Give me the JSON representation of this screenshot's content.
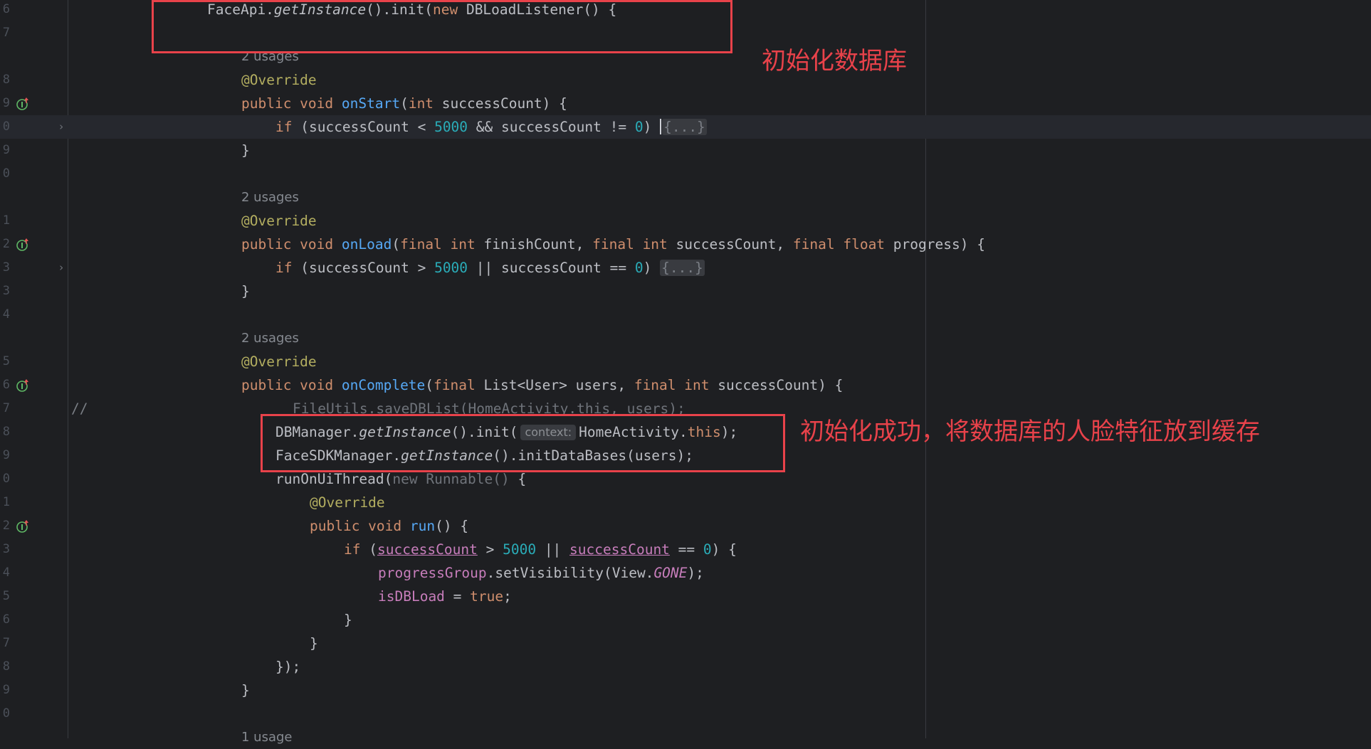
{
  "editor": {
    "lines": [
      {
        "n": "6",
        "hint": "",
        "code": [
          [
            "",
            "FaceApi."
          ],
          [
            "it",
            "getInstance"
          ],
          [
            "",
            "().init("
          ],
          [
            "kw",
            "new "
          ],
          [
            "",
            "DBLoadListener() {"
          ]
        ]
      },
      {
        "n": "7",
        "hint": "",
        "code": []
      },
      {
        "n": "",
        "hint": "2 usages",
        "code": []
      },
      {
        "n": "8",
        "hint": "",
        "code": [
          [
            "ann",
            "@Override"
          ]
        ]
      },
      {
        "n": "9",
        "hint": "",
        "icon": true,
        "code": [
          [
            "kw",
            "public void "
          ],
          [
            "fn",
            "onStart"
          ],
          [
            "",
            "("
          ],
          [
            "kw",
            "int "
          ],
          [
            "",
            "successCount) {"
          ]
        ]
      },
      {
        "n": "0",
        "hint": "",
        "current": true,
        "fold": true,
        "code": [
          [
            "kw",
            "if "
          ],
          [
            "",
            "(successCount < "
          ],
          [
            "num",
            "5000"
          ],
          [
            "",
            " && successCount != "
          ],
          [
            "num",
            "0"
          ],
          [
            "",
            ") "
          ],
          [
            "caret",
            ""
          ],
          [
            "foldph",
            "{...}"
          ]
        ]
      },
      {
        "n": "9",
        "hint": "",
        "code": [
          [
            "",
            "}"
          ]
        ]
      },
      {
        "n": "0",
        "hint": "",
        "code": []
      },
      {
        "n": "",
        "hint": "2 usages",
        "code": []
      },
      {
        "n": "1",
        "hint": "",
        "code": [
          [
            "ann",
            "@Override"
          ]
        ]
      },
      {
        "n": "2",
        "hint": "",
        "icon": true,
        "code": [
          [
            "kw",
            "public void "
          ],
          [
            "fn",
            "onLoad"
          ],
          [
            "",
            "("
          ],
          [
            "kw",
            "final int "
          ],
          [
            "",
            "finishCount, "
          ],
          [
            "kw",
            "final int "
          ],
          [
            "",
            "successCount, "
          ],
          [
            "kw",
            "final float "
          ],
          [
            "",
            "progress) {"
          ]
        ]
      },
      {
        "n": "3",
        "hint": "",
        "fold": true,
        "code": [
          [
            "kw",
            "if "
          ],
          [
            "",
            "(successCount > "
          ],
          [
            "num",
            "5000"
          ],
          [
            "",
            " || successCount == "
          ],
          [
            "num",
            "0"
          ],
          [
            "",
            ") "
          ],
          [
            "foldph",
            "{...}"
          ]
        ]
      },
      {
        "n": "3",
        "hint": "",
        "code": [
          [
            "",
            "}"
          ]
        ]
      },
      {
        "n": "4",
        "hint": "",
        "code": []
      },
      {
        "n": "",
        "hint": "2 usages",
        "code": []
      },
      {
        "n": "5",
        "hint": "",
        "code": [
          [
            "ann",
            "@Override"
          ]
        ]
      },
      {
        "n": "6",
        "hint": "",
        "icon": true,
        "code": [
          [
            "kw",
            "public void "
          ],
          [
            "fn",
            "onComplete"
          ],
          [
            "",
            "("
          ],
          [
            "kw",
            "final "
          ],
          [
            "",
            "List<User> users, "
          ],
          [
            "kw",
            "final int "
          ],
          [
            "",
            "successCount) {"
          ]
        ]
      },
      {
        "n": "7",
        "hint": "",
        "slash": "//",
        "code": [
          [
            "dim",
            "FileUtils.saveDBList(HomeActivity.this, users);"
          ]
        ]
      },
      {
        "n": "8",
        "hint": "",
        "code": [
          [
            "",
            "DBManager."
          ],
          [
            "it",
            "getInstance"
          ],
          [
            "",
            "().init("
          ],
          [
            "inlay",
            "context:"
          ],
          [
            "",
            "HomeActivity."
          ],
          [
            "kw",
            "this"
          ],
          [
            "",
            ");"
          ]
        ]
      },
      {
        "n": "9",
        "hint": "",
        "code": [
          [
            "",
            "FaceSDKManager."
          ],
          [
            "it",
            "getInstance"
          ],
          [
            "",
            "().initDataBases(users);"
          ]
        ]
      },
      {
        "n": "0",
        "hint": "",
        "code": [
          [
            "",
            "runOnUiThread("
          ],
          [
            "dim",
            "new Runnable() "
          ],
          [
            "",
            "{"
          ]
        ]
      },
      {
        "n": "1",
        "hint": "",
        "code": [
          [
            "ann",
            "@Override"
          ]
        ]
      },
      {
        "n": "2",
        "hint": "",
        "icon": true,
        "code": [
          [
            "kw",
            "public void "
          ],
          [
            "fn",
            "run"
          ],
          [
            "",
            "() {"
          ]
        ]
      },
      {
        "n": "3",
        "hint": "",
        "code": [
          [
            "kw",
            "if "
          ],
          [
            "",
            "("
          ],
          [
            "fldu",
            "successCount"
          ],
          [
            "",
            " > "
          ],
          [
            "num",
            "5000"
          ],
          [
            "",
            " || "
          ],
          [
            "fldu",
            "successCount"
          ],
          [
            "",
            " == "
          ],
          [
            "num",
            "0"
          ],
          [
            "",
            ") {"
          ]
        ]
      },
      {
        "n": "4",
        "hint": "",
        "code": [
          [
            "fld",
            "progressGroup"
          ],
          [
            "",
            ".setVisibility(View."
          ],
          [
            "const",
            "GONE"
          ],
          [
            "",
            ");"
          ]
        ]
      },
      {
        "n": "5",
        "hint": "",
        "code": [
          [
            "fld",
            "isDBLoad"
          ],
          [
            "",
            " = "
          ],
          [
            "kw",
            "true"
          ],
          [
            "",
            ";"
          ]
        ]
      },
      {
        "n": "6",
        "hint": "",
        "code": [
          [
            "",
            "}"
          ]
        ]
      },
      {
        "n": "7",
        "hint": "",
        "code": [
          [
            "",
            "}"
          ]
        ]
      },
      {
        "n": "8",
        "hint": "",
        "code": [
          [
            "",
            "});"
          ]
        ]
      },
      {
        "n": "9",
        "hint": "",
        "code": [
          [
            "",
            "}"
          ]
        ]
      },
      {
        "n": "0",
        "hint": "",
        "code": []
      },
      {
        "n": "",
        "hint": "1 usage",
        "code": []
      }
    ]
  },
  "annotations": {
    "note_init_db": "初始化数据库",
    "note_init_success": "初始化成功，将数据库的人脸特征放到缓存"
  },
  "colors": {
    "annotation_red": "#e8424a",
    "background": "#1e1f22"
  }
}
